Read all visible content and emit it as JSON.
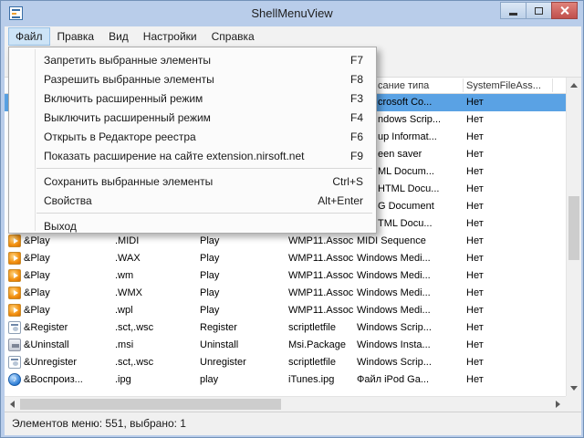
{
  "window": {
    "title": "ShellMenuView"
  },
  "menubar": {
    "items": [
      {
        "label": "Файл",
        "active": true
      },
      {
        "label": "Правка"
      },
      {
        "label": "Вид"
      },
      {
        "label": "Настройки"
      },
      {
        "label": "Справка"
      }
    ]
  },
  "file_menu": {
    "items": [
      {
        "label": "Запретить выбранные элементы",
        "shortcut": "F7"
      },
      {
        "label": "Разрешить выбранные элементы",
        "shortcut": "F8"
      },
      {
        "label": "Включить расширенный режим",
        "shortcut": "F3"
      },
      {
        "label": "Выключить расширенный режим",
        "shortcut": "F4"
      },
      {
        "label": "Открыть в Редакторе реестра",
        "shortcut": "F6"
      },
      {
        "label": "Показать расширение на сайте extension.nirsoft.net",
        "shortcut": "F9"
      },
      {
        "label": "Сохранить выбранные элементы",
        "shortcut": "Ctrl+S"
      },
      {
        "label": "Свойства",
        "shortcut": "Alt+Enter"
      },
      {
        "label": "Выход",
        "shortcut": ""
      }
    ]
  },
  "list": {
    "visible_headers": [
      {
        "label": "сание типа"
      },
      {
        "label": "SystemFileAss..."
      }
    ],
    "partial_rows": [
      {
        "type_description": "crosoft Co...",
        "system_file": "Нет",
        "selected": true
      },
      {
        "type_description": "ndows Scrip...",
        "system_file": "Нет"
      },
      {
        "type_description": "up Informat...",
        "system_file": "Нет"
      },
      {
        "type_description": "een saver",
        "system_file": "Нет"
      },
      {
        "type_description": "ML Docum...",
        "system_file": "Нет"
      },
      {
        "type_description": "HTML Docu...",
        "system_file": "Нет"
      },
      {
        "type_description": "G Document",
        "system_file": "Нет"
      },
      {
        "type_description": "TML Docu...",
        "system_file": "Нет"
      }
    ],
    "rows": [
      {
        "icon": "wmp-play-icon",
        "menu_name": "&Play",
        "extension": ".MIDI",
        "title": "Play",
        "file_class": "WMP11.Assoc...",
        "type_description": "MIDI Sequence",
        "system_file": "Нет"
      },
      {
        "icon": "wmp-play-icon",
        "menu_name": "&Play",
        "extension": ".WAX",
        "title": "Play",
        "file_class": "WMP11.Assoc...",
        "type_description": "Windows Medi...",
        "system_file": "Нет"
      },
      {
        "icon": "wmp-play-icon",
        "menu_name": "&Play",
        "extension": ".wm",
        "title": "Play",
        "file_class": "WMP11.Assoc...",
        "type_description": "Windows Medi...",
        "system_file": "Нет"
      },
      {
        "icon": "wmp-play-icon",
        "menu_name": "&Play",
        "extension": ".WMX",
        "title": "Play",
        "file_class": "WMP11.Assoc...",
        "type_description": "Windows Medi...",
        "system_file": "Нет"
      },
      {
        "icon": "wmp-play-icon",
        "menu_name": "&Play",
        "extension": ".wpl",
        "title": "Play",
        "file_class": "WMP11.Assoc...",
        "type_description": "Windows Medi...",
        "system_file": "Нет"
      },
      {
        "icon": "scriptlet-icon",
        "menu_name": "&Register",
        "extension": ".sct,.wsc",
        "title": "Register",
        "file_class": "scriptletfile",
        "type_description": "Windows Scrip...",
        "system_file": "Нет"
      },
      {
        "icon": "msi-package-icon",
        "menu_name": "&Uninstall",
        "extension": ".msi",
        "title": "Uninstall",
        "file_class": "Msi.Package",
        "type_description": "Windows Insta...",
        "system_file": "Нет"
      },
      {
        "icon": "scriptlet-icon",
        "menu_name": "&Unregister",
        "extension": ".sct,.wsc",
        "title": "Unregister",
        "file_class": "scriptletfile",
        "type_description": "Windows Scrip...",
        "system_file": "Нет"
      },
      {
        "icon": "itunes-icon",
        "menu_name": "&Воспроиз...",
        "extension": ".ipg",
        "title": "play",
        "file_class": "iTunes.ipg",
        "type_description": "Файл iPod Ga...",
        "system_file": "Нет"
      }
    ]
  },
  "statusbar": {
    "text": "Элементов меню: 551, выбрано: 1"
  },
  "colors": {
    "titlebar": "#b9cdea",
    "selection": "#5aa2e4",
    "close_button": "#c0504d"
  }
}
